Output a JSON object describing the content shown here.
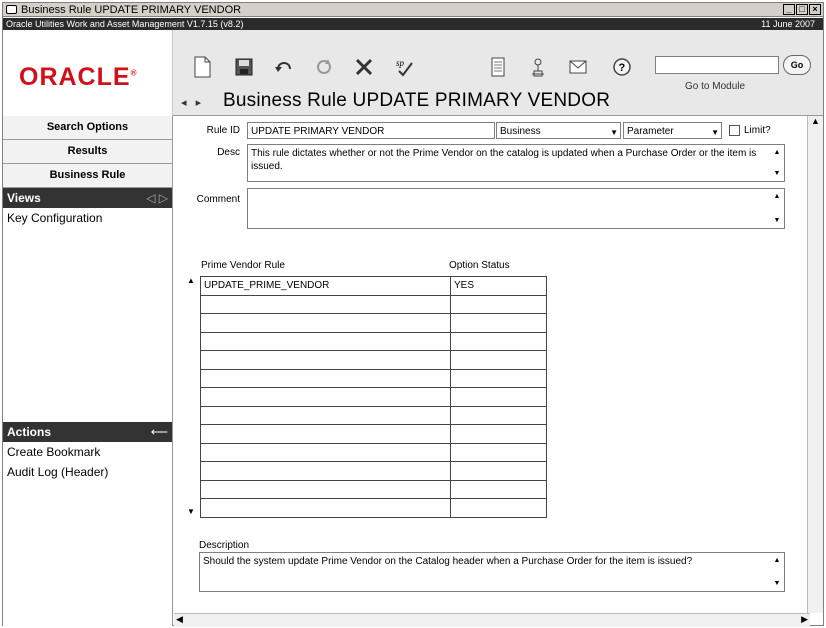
{
  "window": {
    "title": "Business Rule UPDATE PRIMARY VENDOR",
    "version": "Oracle Utilities Work and Asset Management V1.7.15 (v8.2)",
    "date": "11 June   2007"
  },
  "header": {
    "logo": "ORACLE",
    "page_title": "Business Rule UPDATE PRIMARY VENDOR",
    "goto_label": "Go to Module",
    "go_button": "Go",
    "goto_value": ""
  },
  "sidebar": {
    "buttons": [
      "Search Options",
      "Results",
      "Business Rule"
    ],
    "views_title": "Views",
    "views_items": [
      "Key Configuration"
    ],
    "actions_title": "Actions",
    "actions_items": [
      "Create Bookmark",
      "Audit Log (Header)"
    ]
  },
  "form": {
    "rule_id_label": "Rule ID",
    "rule_id_value": "UPDATE PRIMARY VENDOR",
    "type_value": "Business",
    "kind_value": "Parameter",
    "limit_label": "Limit?",
    "desc_label": "Desc",
    "desc_value": "This rule dictates whether or not the Prime Vendor on the catalog is updated when a Purchase Order or the item is issued.",
    "comment_label": "Comment",
    "comment_value": ""
  },
  "grid": {
    "col1_header": "Prime Vendor Rule",
    "col2_header": "Option Status",
    "rows": [
      [
        "UPDATE_PRIME_VENDOR",
        "YES"
      ],
      [
        "",
        ""
      ],
      [
        "",
        ""
      ],
      [
        "",
        ""
      ],
      [
        "",
        ""
      ],
      [
        "",
        ""
      ],
      [
        "",
        ""
      ],
      [
        "",
        ""
      ],
      [
        "",
        ""
      ],
      [
        "",
        ""
      ],
      [
        "",
        ""
      ],
      [
        "",
        ""
      ],
      [
        "",
        ""
      ]
    ]
  },
  "description": {
    "label": "Description",
    "value": "Should the system update Prime Vendor on the Catalog header when a Purchase Order for the item is issued?"
  }
}
